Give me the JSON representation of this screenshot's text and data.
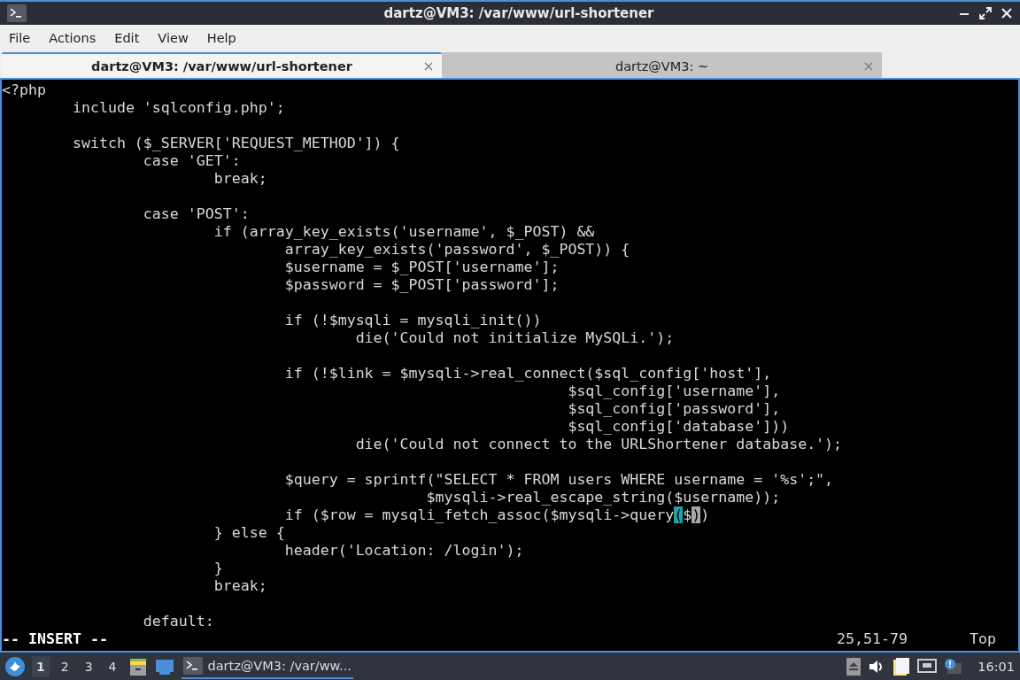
{
  "window": {
    "title": "dartz@VM3: /var/www/url-shortener"
  },
  "menu": [
    "File",
    "Actions",
    "Edit",
    "View",
    "Help"
  ],
  "tabs": [
    {
      "label": "dartz@VM3: /var/www/url-shortener",
      "selected": true
    },
    {
      "label": "dartz@VM3: ~",
      "selected": false
    }
  ],
  "editor": {
    "lines": [
      {
        "kind": "text",
        "text": "<?php"
      },
      {
        "kind": "text",
        "text": "\tinclude 'sqlconfig.php';"
      },
      {
        "kind": "blank"
      },
      {
        "kind": "text",
        "text": "\tswitch ($_SERVER['REQUEST_METHOD']) {"
      },
      {
        "kind": "text",
        "text": "\t\tcase 'GET':"
      },
      {
        "kind": "text",
        "text": "\t\t\tbreak;"
      },
      {
        "kind": "blank"
      },
      {
        "kind": "text",
        "text": "\t\tcase 'POST':"
      },
      {
        "kind": "text",
        "text": "\t\t\tif (array_key_exists('username', $_POST) &&"
      },
      {
        "kind": "text",
        "text": "\t\t\t\tarray_key_exists('password', $_POST)) {"
      },
      {
        "kind": "text",
        "text": "\t\t\t\t$username = $_POST['username'];"
      },
      {
        "kind": "text",
        "text": "\t\t\t\t$password = $_POST['password'];"
      },
      {
        "kind": "blank"
      },
      {
        "kind": "text",
        "text": "\t\t\t\tif (!$mysqli = mysqli_init())"
      },
      {
        "kind": "text",
        "text": "\t\t\t\t\tdie('Could not initialize MySQLi.');"
      },
      {
        "kind": "blank"
      },
      {
        "kind": "text",
        "text": "\t\t\t\tif (!$link = $mysqli->real_connect($sql_config['host'],"
      },
      {
        "kind": "text",
        "text": "\t\t\t\t\t\t\t\t$sql_config['username'],"
      },
      {
        "kind": "text",
        "text": "\t\t\t\t\t\t\t\t$sql_config['password'],"
      },
      {
        "kind": "text",
        "text": "\t\t\t\t\t\t\t\t$sql_config['database']))"
      },
      {
        "kind": "text",
        "text": "\t\t\t\t\tdie('Could not connect to the URLShortener database.');"
      },
      {
        "kind": "blank"
      },
      {
        "kind": "text",
        "text": "\t\t\t\t$query = sprintf(\"SELECT * FROM users WHERE username = '%s';\","
      },
      {
        "kind": "text",
        "text": "\t\t\t\t\t\t$mysqli->real_escape_string($username));"
      },
      {
        "kind": "cursor",
        "before": "\t\t\t\tif ($row = mysqli_fetch_assoc($mysqli->query",
        "match": "(",
        "middle": "$",
        "cursor": ")",
        "after": ")"
      },
      {
        "kind": "text",
        "text": "\t\t\t} else {"
      },
      {
        "kind": "text",
        "text": "\t\t\t\theader('Location: /login');"
      },
      {
        "kind": "text",
        "text": "\t\t\t}"
      },
      {
        "kind": "text",
        "text": "\t\t\tbreak;"
      },
      {
        "kind": "blank"
      },
      {
        "kind": "text",
        "text": "\t\tdefault:"
      }
    ]
  },
  "status_bar": {
    "mode": "-- INSERT --",
    "position": "25,51-79",
    "scroll": "Top"
  },
  "taskbar": {
    "workspaces": [
      {
        "label": "1",
        "selected": true
      },
      {
        "label": "2",
        "selected": false
      },
      {
        "label": "3",
        "selected": false
      },
      {
        "label": "4",
        "selected": false
      }
    ],
    "task": "dartz@VM3: /var/ww...",
    "clock": "16:01"
  }
}
